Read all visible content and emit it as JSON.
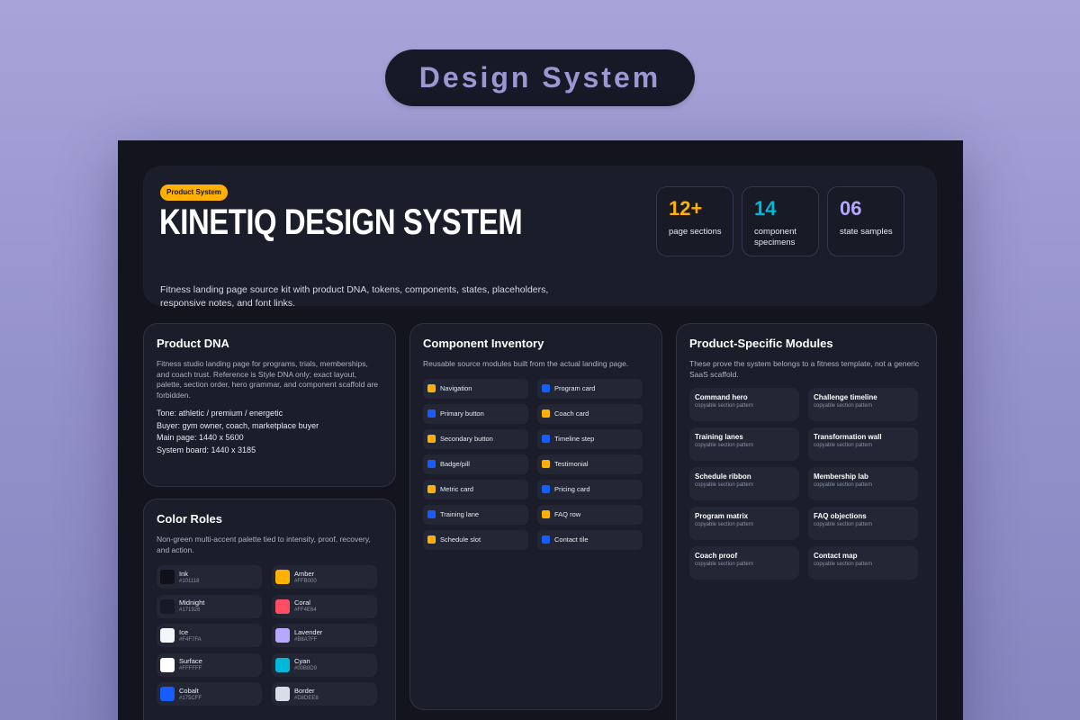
{
  "page_title": "Design System",
  "hero": {
    "badge": "Product System",
    "title": "KINETIQ DESIGN SYSTEM",
    "description": "Fitness landing page source kit with product DNA, tokens, components, states, placeholders, responsive notes, and font links.",
    "stats": [
      {
        "value": "12+",
        "label": "page sections",
        "color": "#ffb000"
      },
      {
        "value": "14",
        "label": "component specimens",
        "color": "#00b8d9"
      },
      {
        "value": "06",
        "label": "state samples",
        "color": "#b8a7ff"
      }
    ]
  },
  "product_dna": {
    "heading": "Product DNA",
    "description": "Fitness studio landing page for programs, trials, memberships, and coach trust. Reference is Style DNA only; exact layout, palette, section order, hero grammar, and component scaffold are forbidden.",
    "facts": [
      "Tone: athletic / premium / energetic",
      "Buyer: gym owner, coach, marketplace buyer",
      "Main page: 1440 x 5600",
      "System board: 1440 x 3185"
    ]
  },
  "color_roles": {
    "heading": "Color Roles",
    "description": "Non-green multi-accent palette tied to intensity, proof, recovery, and action.",
    "swatches": [
      {
        "name": "Ink",
        "hex": "#101118"
      },
      {
        "name": "Amber",
        "hex": "#FFB000"
      },
      {
        "name": "Midnight",
        "hex": "#171926"
      },
      {
        "name": "Coral",
        "hex": "#FF4E64"
      },
      {
        "name": "Ice",
        "hex": "#F4F7FA"
      },
      {
        "name": "Lavender",
        "hex": "#B8A7FF"
      },
      {
        "name": "Surface",
        "hex": "#FFFFFF"
      },
      {
        "name": "Cyan",
        "hex": "#00B8D9"
      },
      {
        "name": "Cobalt",
        "hex": "#175CFF"
      },
      {
        "name": "Border",
        "hex": "#D8DEE8"
      }
    ]
  },
  "component_inventory": {
    "heading": "Component Inventory",
    "description": "Reusable source modules built from the actual landing page.",
    "items": [
      {
        "label": "Navigation",
        "color": "#ffb000"
      },
      {
        "label": "Program card",
        "color": "#175cff"
      },
      {
        "label": "Primary button",
        "color": "#175cff"
      },
      {
        "label": "Coach card",
        "color": "#ffb000"
      },
      {
        "label": "Secondary button",
        "color": "#ffb000"
      },
      {
        "label": "Timeline step",
        "color": "#175cff"
      },
      {
        "label": "Badge/pill",
        "color": "#175cff"
      },
      {
        "label": "Testimonial",
        "color": "#ffb000"
      },
      {
        "label": "Metric card",
        "color": "#ffb000"
      },
      {
        "label": "Pricing card",
        "color": "#175cff"
      },
      {
        "label": "Training lane",
        "color": "#175cff"
      },
      {
        "label": "FAQ row",
        "color": "#ffb000"
      },
      {
        "label": "Schedule slot",
        "color": "#ffb000"
      },
      {
        "label": "Contact tile",
        "color": "#175cff"
      }
    ]
  },
  "modules": {
    "heading": "Product-Specific Modules",
    "description": "These prove the system belongs to a fitness template, not a generic SaaS scaffold.",
    "items": [
      {
        "title": "Command hero",
        "subtitle": "copyable section pattern"
      },
      {
        "title": "Challenge timeline",
        "subtitle": "copyable section pattern"
      },
      {
        "title": "Training lanes",
        "subtitle": "copyable section pattern"
      },
      {
        "title": "Transformation wall",
        "subtitle": "copyable section pattern"
      },
      {
        "title": "Schedule ribbon",
        "subtitle": "copyable section pattern"
      },
      {
        "title": "Membership lab",
        "subtitle": "copyable section pattern"
      },
      {
        "title": "Program matrix",
        "subtitle": "copyable section pattern"
      },
      {
        "title": "FAQ objections",
        "subtitle": "copyable section pattern"
      },
      {
        "title": "Coach proof",
        "subtitle": "copyable section pattern"
      },
      {
        "title": "Contact map",
        "subtitle": "copyable section pattern"
      }
    ]
  }
}
